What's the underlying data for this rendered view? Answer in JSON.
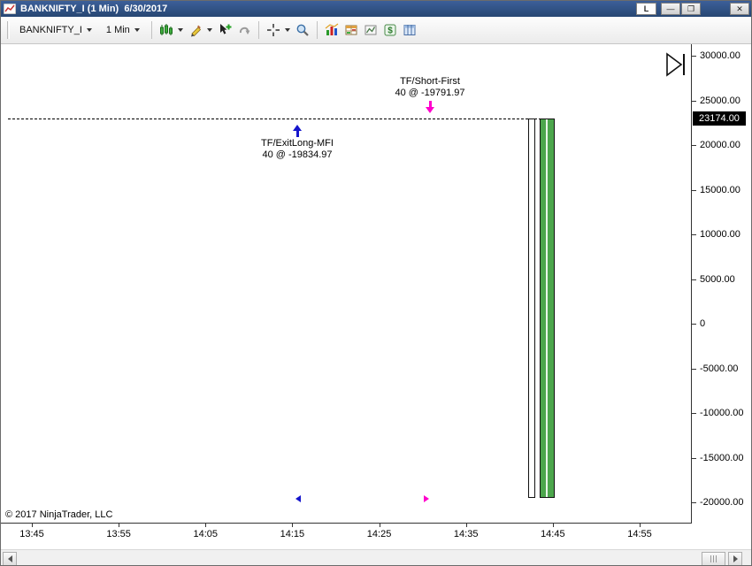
{
  "window": {
    "title": "BANKNIFTY_I (1 Min)  6/30/2017",
    "l_button": "L",
    "minimize_glyph": "—",
    "maximize_glyph": "❐",
    "close_glyph": "✕"
  },
  "toolbar": {
    "instrument": "BANKNIFTY_I",
    "interval": "1 Min",
    "icons": [
      "chart-style-icon",
      "drawing-tools-icon",
      "add-cursor-icon",
      "pan-icon",
      "crosshair-icon",
      "zoom-icon",
      "indicators-icon",
      "chart-analyzer-icon",
      "chart-image-icon",
      "account-dollar-icon",
      "chart-trader-icon"
    ]
  },
  "chart": {
    "copyright": "© 2017 NinjaTrader, LLC",
    "price_badge": "23174.00",
    "annotations": {
      "short": {
        "line1": "TF/Short-First",
        "line2": "40 @ -19791.97"
      },
      "exit_long": {
        "line1": "TF/ExitLong-MFI",
        "line2": "40 @ -19834.97"
      }
    },
    "y_axis": {
      "ticks": [
        "30000.00",
        "25000.00",
        "20000.00",
        "15000.00",
        "10000.00",
        "5000.00",
        "0",
        "-5000.00",
        "-10000.00",
        "-15000.00",
        "-20000.00"
      ]
    },
    "x_axis": {
      "ticks": [
        "13:45",
        "13:55",
        "14:05",
        "14:15",
        "14:25",
        "14:35",
        "14:45",
        "14:55"
      ]
    }
  },
  "colors": {
    "up_arrow": "#1515cc",
    "down_arrow": "#ff00cc",
    "bar_green": "#4ca64c",
    "badge_bg": "#000000"
  }
}
